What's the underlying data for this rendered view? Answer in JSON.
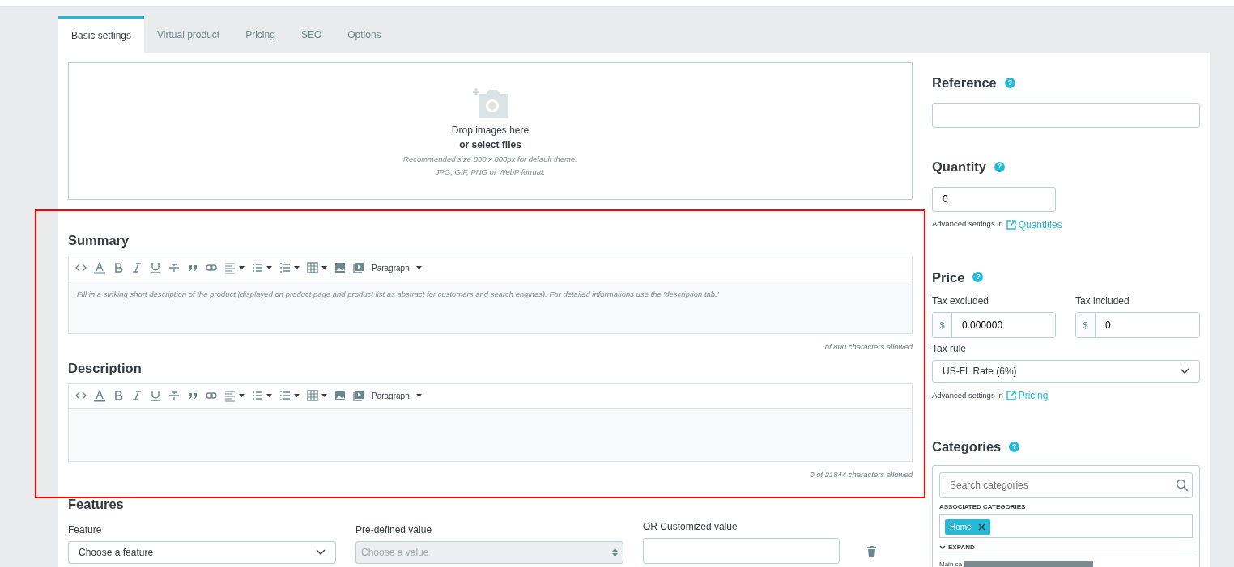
{
  "tabs": [
    {
      "label": "Basic settings",
      "selected": true
    },
    {
      "label": "Virtual product",
      "selected": false
    },
    {
      "label": "Pricing",
      "selected": false
    },
    {
      "label": "SEO",
      "selected": false
    },
    {
      "label": "Options",
      "selected": false
    }
  ],
  "dropzone": {
    "title": "Drop images here",
    "link": "or select files",
    "hints": [
      "Recommended size 800 x 800px for default theme.",
      "JPG, GIF, PNG or WebP format."
    ]
  },
  "editors": [
    {
      "heading": "Summary",
      "format": "Paragraph",
      "placeholder": "Fill in a striking short description of the product (displayed on product page and product list as abstract for customers and search engines). For detailed informations use the 'description tab.'",
      "counter": "of 800 characters allowed"
    },
    {
      "heading": "Description",
      "format": "Paragraph",
      "counter": "0 of 21844 characters allowed"
    }
  ],
  "features": {
    "heading": "Features",
    "feature_label": "Feature",
    "feature_value": "Choose a feature",
    "predefined_label": "Pre-defined value",
    "predefined_placeholder": "Choose a value",
    "predefined_disabled": true,
    "custom_label": "OR Customized value"
  },
  "reference": {
    "heading": "Reference",
    "help": "?"
  },
  "quantity": {
    "heading": "Quantity",
    "help": "?",
    "value": "0",
    "advanced": "Advanced settings in",
    "link": "Quantities"
  },
  "price": {
    "heading": "Price",
    "help": "?",
    "excl_label": "Tax excluded",
    "excl_currency": "$",
    "excl_value": "0.000000",
    "incl_label": "Tax included",
    "incl_currency": "$",
    "incl_value": "0",
    "rule_label": "Tax rule",
    "rule_value": "US-FL Rate (6%)",
    "advanced": "Advanced settings in",
    "link": "Pricing"
  },
  "categories": {
    "heading": "Categories",
    "help": "?",
    "search_placeholder": "Search categories",
    "associated_label": "ASSOCIATED CATEGORIES",
    "tags": [
      "Home"
    ],
    "expand": "EXPAND",
    "main_label": "Main ca"
  },
  "annotation": {
    "kind": "rectangle",
    "color": "#ff0000"
  }
}
